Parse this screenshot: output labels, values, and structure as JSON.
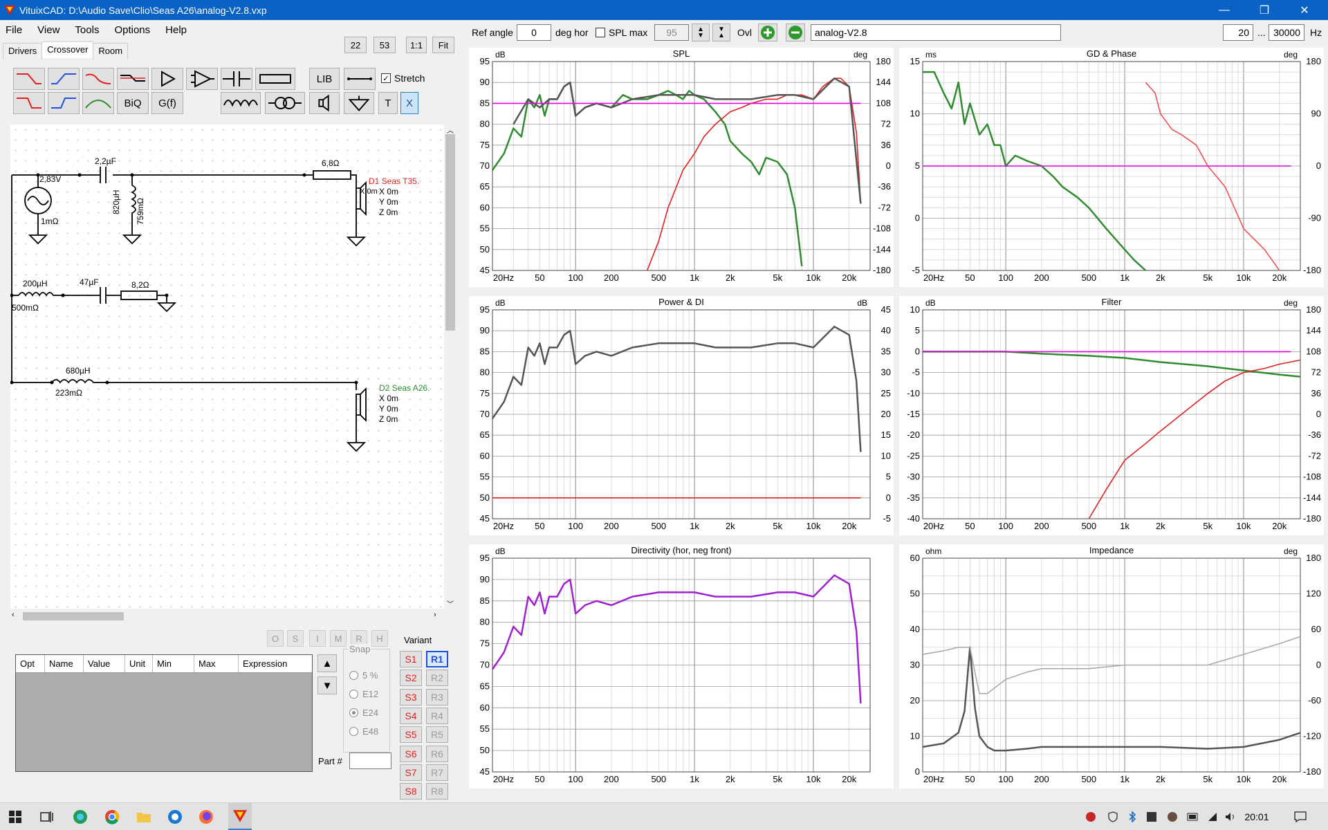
{
  "window": {
    "title": "VituixCAD: D:\\Audio Save\\Clio\\Seas A26\\analog-V2.8.vxp",
    "min": "—",
    "max": "❐",
    "close": "✕"
  },
  "menu": [
    "File",
    "View",
    "Tools",
    "Options",
    "Help"
  ],
  "tabs": [
    "Drivers",
    "Crossover",
    "Room"
  ],
  "zoom": [
    "22",
    "53",
    "1:1",
    "Fit"
  ],
  "comp_buttons": {
    "biq": "BiQ",
    "gf": "G(f)",
    "lib": "LIB",
    "t": "T",
    "x": "X",
    "stretch": "Stretch"
  },
  "top": {
    "ref_angle_label": "Ref angle",
    "ref_angle_value": "0",
    "deg_hor": "deg hor",
    "spl_max": "SPL max",
    "spl_max_value": "95",
    "ovl": "Ovl",
    "variant_name": "analog-V2.8",
    "fmin": "20",
    "dots": "...",
    "fmax": "30000",
    "hz": "Hz"
  },
  "schematic": {
    "v_source": "2,83V",
    "v_source_r": "1mΩ",
    "c1": "2,2µF",
    "l1": "820µH",
    "l1_r": "759mΩ",
    "r1": "6,8Ω",
    "d1_name": "D1 Seas T35.",
    "d1_x": "X 0m",
    "d1_y": "Y 0m",
    "d1_z": "Z 0m",
    "l2": "200µH",
    "l2_r": "500mΩ",
    "c2": "47µF",
    "r2": "8,2Ω",
    "l3": "680µH",
    "l3_r": "223mΩ",
    "d2_name": "D2 Seas A26.",
    "d2_x": "X 0m",
    "d2_y": "Y 0m",
    "d2_z": "Z 0m"
  },
  "opt_buttons": [
    "O",
    "S",
    "I",
    "M",
    "R",
    "H"
  ],
  "param_table": {
    "columns": [
      "Opt",
      "Name",
      "Value",
      "Unit",
      "Min",
      "Max",
      "Expression"
    ]
  },
  "snap": {
    "label": "Snap",
    "options": [
      "5 %",
      "E12",
      "E24",
      "E48"
    ],
    "selected": "E24"
  },
  "part": {
    "label": "Part #"
  },
  "variant": {
    "label": "Variant",
    "s": [
      "S1",
      "S2",
      "S3",
      "S4",
      "S5",
      "S6",
      "S7",
      "S8"
    ],
    "r": [
      "R1",
      "R2",
      "R3",
      "R4",
      "R5",
      "R6",
      "R7",
      "R8"
    ],
    "active": "R1"
  },
  "colors": {
    "green": "#2e8b2e",
    "red": "#e02020",
    "magenta": "#e000e0",
    "gray": "#5a5a5a",
    "purple": "#a020d0",
    "light_red": "#f05050",
    "light_green": "#40a040"
  },
  "chart_data": [
    {
      "title": "SPL",
      "type": "line",
      "xscale": "log",
      "xlim": [
        20,
        30000
      ],
      "ylim": [
        45,
        95
      ],
      "yunit": "dB",
      "y2unit": "deg",
      "y2lim": [
        -180,
        180
      ],
      "xticks": [
        "20Hz",
        "50",
        "100",
        "200",
        "500",
        "1k",
        "2k",
        "5k",
        "10k",
        "20k"
      ],
      "yticks": [
        "95",
        "90",
        "85",
        "80",
        "75",
        "70",
        "65",
        "60",
        "55",
        "50",
        "45"
      ],
      "y2ticks": [
        "180",
        "144",
        "108",
        "72",
        "36",
        "0",
        "-36",
        "-72",
        "-108",
        "-144",
        "-180"
      ],
      "series": [
        {
          "color": "#2e8b2e",
          "x": [
            20,
            25,
            30,
            35,
            40,
            45,
            50,
            55,
            60,
            70,
            80,
            90,
            100,
            120,
            150,
            200,
            250,
            300,
            400,
            500,
            600,
            700,
            800,
            900,
            1000,
            1200,
            1500,
            1800,
            2000,
            2500,
            3000,
            3500,
            4000,
            5000,
            6000,
            7000,
            8000
          ],
          "y": [
            69,
            73,
            79,
            77,
            86,
            84,
            87,
            82,
            86,
            86,
            89,
            90,
            82,
            84,
            85,
            84,
            87,
            86,
            86,
            87,
            88,
            87,
            86,
            88,
            87,
            86,
            83,
            80,
            76,
            73,
            71,
            68,
            72,
            71,
            68,
            60,
            46
          ]
        },
        {
          "color": "#e02020",
          "x": [
            400,
            500,
            600,
            800,
            1000,
            1200,
            1500,
            2000,
            2500,
            3000,
            4000,
            5000,
            6000,
            8000,
            10000,
            12000,
            15000,
            17000,
            20000,
            23000,
            25000
          ],
          "y": [
            45,
            52,
            60,
            69,
            73,
            77,
            80,
            83,
            84,
            85,
            86,
            86,
            87,
            87,
            86,
            89,
            91,
            91,
            89,
            78,
            61
          ]
        },
        {
          "color": "#555555",
          "x": [
            30,
            40,
            50,
            60,
            70,
            80,
            90,
            100,
            120,
            150,
            200,
            300,
            500,
            700,
            1000,
            1500,
            2000,
            3000,
            5000,
            7000,
            10000,
            15000,
            20000,
            25000
          ],
          "y": [
            80,
            86,
            84,
            86,
            86,
            89,
            90,
            82,
            84,
            85,
            84,
            86,
            87,
            87,
            87,
            86,
            86,
            86,
            87,
            87,
            86,
            91,
            89,
            61
          ]
        },
        {
          "color": "#e000e0",
          "x": [
            20,
            25000
          ],
          "y": [
            85,
            85
          ]
        }
      ]
    },
    {
      "title": "GD & Phase",
      "type": "line",
      "xscale": "log",
      "xlim": [
        20,
        30000
      ],
      "ylim": [
        -5,
        15
      ],
      "yunit": "ms",
      "y2unit": "deg",
      "y2lim": [
        -180,
        180
      ],
      "xticks": [
        "20Hz",
        "50",
        "100",
        "200",
        "500",
        "1k",
        "2k",
        "5k",
        "10k",
        "20k"
      ],
      "yticks": [
        "15",
        "10",
        "5",
        "0",
        "-5"
      ],
      "y2ticks": [
        "180",
        "90",
        "0",
        "-90",
        "-180"
      ],
      "series": [
        {
          "color": "#2e8b2e",
          "x": [
            20,
            25,
            30,
            35,
            40,
            45,
            50,
            60,
            70,
            80,
            90,
            100,
            120,
            150,
            200,
            250,
            300,
            400,
            500,
            700,
            1000,
            1200,
            1500
          ],
          "y": [
            14,
            14,
            12,
            10.5,
            13,
            9,
            11,
            8,
            9,
            7,
            7,
            5,
            6,
            5.5,
            5,
            4,
            3,
            2,
            1,
            -1,
            -3,
            -4,
            -5
          ]
        },
        {
          "color": "#f05050",
          "x": [
            1500,
            1800,
            2000,
            2500,
            3000,
            4000,
            5000,
            7000,
            10000,
            15000,
            20000
          ],
          "y": [
            13,
            12,
            10,
            8.5,
            8,
            7,
            5,
            3,
            -1,
            -3,
            -5
          ]
        },
        {
          "color": "#e000e0",
          "x": [
            20,
            25000
          ],
          "y": [
            5,
            5
          ]
        }
      ]
    },
    {
      "title": "Power & DI",
      "type": "line",
      "xscale": "log",
      "xlim": [
        20,
        30000
      ],
      "ylim": [
        45,
        95
      ],
      "yunit": "dB",
      "y2unit": "dB",
      "y2lim": [
        -5,
        45
      ],
      "xticks": [
        "20Hz",
        "50",
        "100",
        "200",
        "500",
        "1k",
        "2k",
        "5k",
        "10k",
        "20k"
      ],
      "yticks": [
        "95",
        "90",
        "85",
        "80",
        "75",
        "70",
        "65",
        "60",
        "55",
        "50",
        "45"
      ],
      "y2ticks": [
        "45",
        "40",
        "35",
        "30",
        "25",
        "20",
        "15",
        "10",
        "5",
        "0",
        "-5"
      ],
      "series": [
        {
          "color": "#555555",
          "x": [
            20,
            25,
            30,
            35,
            40,
            45,
            50,
            55,
            60,
            70,
            80,
            90,
            100,
            120,
            150,
            200,
            300,
            500,
            700,
            1000,
            1500,
            2000,
            3000,
            5000,
            7000,
            10000,
            15000,
            20000,
            23000,
            25000
          ],
          "y": [
            69,
            73,
            79,
            77,
            86,
            84,
            87,
            82,
            86,
            86,
            89,
            90,
            82,
            84,
            85,
            84,
            86,
            87,
            87,
            87,
            86,
            86,
            86,
            87,
            87,
            86,
            91,
            89,
            78,
            61
          ]
        },
        {
          "color": "#e02020",
          "x": [
            20,
            25000
          ],
          "y": [
            50,
            50
          ]
        }
      ]
    },
    {
      "title": "Filter",
      "type": "line",
      "xscale": "log",
      "xlim": [
        20,
        30000
      ],
      "ylim": [
        -40,
        10
      ],
      "yunit": "dB",
      "y2unit": "deg",
      "y2lim": [
        -180,
        180
      ],
      "xticks": [
        "20Hz",
        "50",
        "100",
        "200",
        "500",
        "1k",
        "2k",
        "5k",
        "10k",
        "20k"
      ],
      "yticks": [
        "10",
        "5",
        "0",
        "-5",
        "-10",
        "-15",
        "-20",
        "-25",
        "-30",
        "-35",
        "-40"
      ],
      "y2ticks": [
        "180",
        "144",
        "108",
        "72",
        "36",
        "0",
        "-36",
        "-72",
        "-108",
        "-144",
        "-180"
      ],
      "series": [
        {
          "color": "#2e8b2e",
          "x": [
            20,
            100,
            200,
            500,
            1000,
            2000,
            5000,
            10000,
            20000,
            30000
          ],
          "y": [
            0,
            0,
            -0.5,
            -1,
            -1.5,
            -2.5,
            -3.5,
            -4.5,
            -5.5,
            -6
          ]
        },
        {
          "color": "#e02020",
          "x": [
            500,
            700,
            1000,
            1500,
            2000,
            3000,
            5000,
            7000,
            10000,
            15000,
            20000,
            30000
          ],
          "y": [
            -40,
            -33,
            -26,
            -22,
            -19,
            -15,
            -10,
            -7,
            -5,
            -4,
            -3,
            -2
          ]
        },
        {
          "color": "#e000e0",
          "x": [
            20,
            25000
          ],
          "y": [
            0,
            0
          ]
        }
      ]
    },
    {
      "title": "Directivity (hor, neg front)",
      "type": "line",
      "xscale": "log",
      "xlim": [
        20,
        30000
      ],
      "ylim": [
        45,
        95
      ],
      "yunit": "dB",
      "xticks": [
        "20Hz",
        "50",
        "100",
        "200",
        "500",
        "1k",
        "2k",
        "5k",
        "10k",
        "20k"
      ],
      "yticks": [
        "95",
        "90",
        "85",
        "80",
        "75",
        "70",
        "65",
        "60",
        "55",
        "50",
        "45"
      ],
      "series": [
        {
          "color": "#a020d0",
          "x": [
            20,
            25,
            30,
            35,
            40,
            45,
            50,
            55,
            60,
            70,
            80,
            90,
            100,
            120,
            150,
            200,
            300,
            500,
            700,
            1000,
            1500,
            2000,
            3000,
            5000,
            7000,
            10000,
            15000,
            20000,
            23000,
            25000
          ],
          "y": [
            69,
            73,
            79,
            77,
            86,
            84,
            87,
            82,
            86,
            86,
            89,
            90,
            82,
            84,
            85,
            84,
            86,
            87,
            87,
            87,
            86,
            86,
            86,
            87,
            87,
            86,
            91,
            89,
            78,
            61
          ]
        }
      ]
    },
    {
      "title": "Impedance",
      "type": "line",
      "xscale": "log",
      "xlim": [
        20,
        30000
      ],
      "ylim": [
        0,
        60
      ],
      "yunit": "ohm",
      "y2unit": "deg",
      "y2lim": [
        -180,
        180
      ],
      "xticks": [
        "20Hz",
        "50",
        "100",
        "200",
        "500",
        "1k",
        "2k",
        "5k",
        "10k",
        "20k"
      ],
      "yticks": [
        "60",
        "50",
        "40",
        "30",
        "20",
        "10",
        "0"
      ],
      "y2ticks": [
        "180",
        "120",
        "60",
        "0",
        "-60",
        "-120",
        "-180"
      ],
      "series": [
        {
          "color": "#555555",
          "x": [
            20,
            30,
            40,
            45,
            50,
            55,
            60,
            70,
            80,
            100,
            150,
            200,
            500,
            1000,
            2000,
            5000,
            10000,
            20000,
            30000
          ],
          "y": [
            7,
            8,
            11,
            17,
            35,
            18,
            10,
            7,
            6,
            6,
            6.5,
            7,
            7,
            7,
            7,
            6.5,
            7,
            9,
            11
          ]
        },
        {
          "color": "#aaaaaa",
          "x": [
            20,
            30,
            40,
            50,
            55,
            60,
            70,
            100,
            150,
            200,
            500,
            1000,
            2000,
            5000,
            10000,
            20000,
            30000
          ],
          "y": [
            33,
            34,
            35,
            35,
            28,
            22,
            22,
            26,
            28,
            29,
            29,
            30,
            30,
            30,
            33,
            36,
            38
          ]
        }
      ]
    }
  ]
}
